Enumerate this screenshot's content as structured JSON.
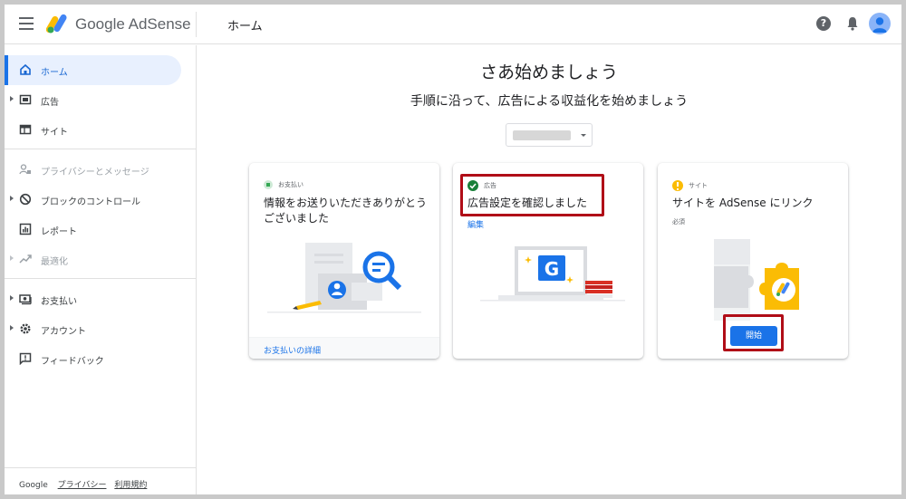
{
  "app": {
    "brand": "Google AdSense",
    "page_header": "ホーム"
  },
  "topbar": {
    "help_label": "?"
  },
  "sidebar": {
    "items": [
      {
        "label": "ホーム",
        "icon": "home-icon",
        "active": true
      },
      {
        "label": "広告",
        "icon": "ads-icon",
        "expandable": true
      },
      {
        "label": "サイト",
        "icon": "sites-icon"
      },
      {
        "label": "プライバシーとメッセージ",
        "icon": "privacy-icon",
        "disabled": true
      },
      {
        "label": "ブロックのコントロール",
        "icon": "block-icon",
        "expandable": true
      },
      {
        "label": "レポート",
        "icon": "reports-icon"
      },
      {
        "label": "最適化",
        "icon": "optimize-icon",
        "expandable": true,
        "disabled": true
      },
      {
        "label": "お支払い",
        "icon": "payments-icon",
        "expandable": true
      },
      {
        "label": "アカウント",
        "icon": "account-gear-icon",
        "expandable": true
      },
      {
        "label": "フィードバック",
        "icon": "feedback-icon"
      }
    ],
    "footer": {
      "google": "Google",
      "privacy": "プライバシー",
      "terms": "利用規約"
    }
  },
  "main": {
    "title": "さあ始めましょう",
    "subtitle": "手順に沿って、広告による収益化を始めましょう"
  },
  "cards": [
    {
      "category": "お支払い",
      "title": "情報をお送りいただきありがとうございました",
      "footer_link": "お支払いの詳細",
      "status_color": "#34a853"
    },
    {
      "category": "広告",
      "title": "広告設定を確認しました",
      "edit_link": "編集",
      "status_color": "#188038"
    },
    {
      "category": "サイト",
      "title": "サイトを AdSense にリンク",
      "required": "必須",
      "button": "開始",
      "status_color": "#fbbc04"
    }
  ],
  "colors": {
    "accent": "#1a73e8",
    "highlight": "#b00d17",
    "active_bg": "#e8f0fe"
  }
}
